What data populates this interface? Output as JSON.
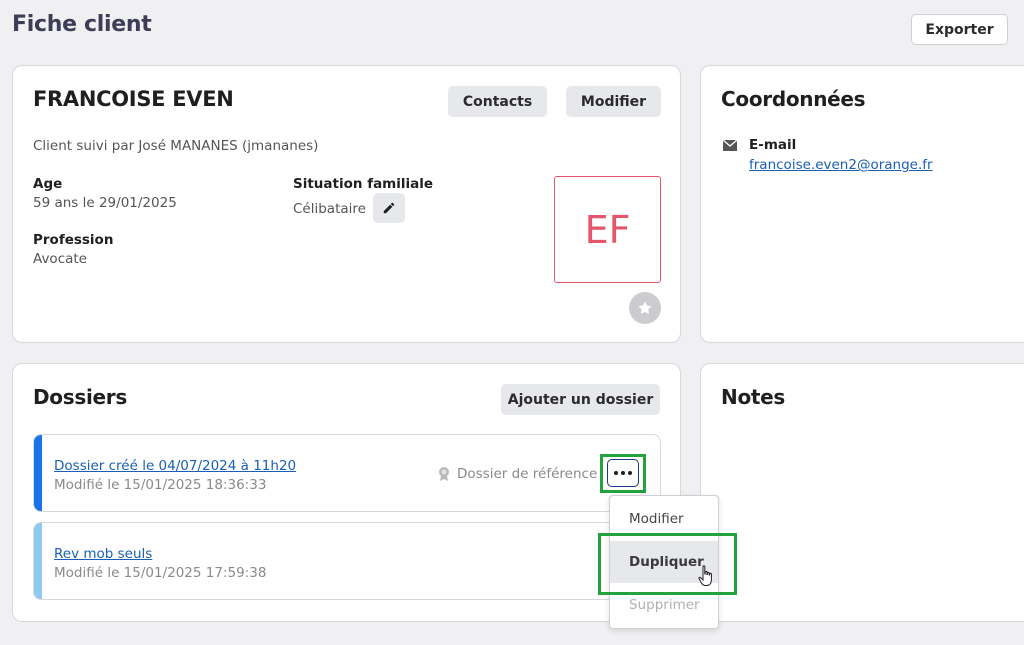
{
  "header": {
    "title": "Fiche client",
    "export_label": "Exporter"
  },
  "client": {
    "name": "FRANCOISE EVEN",
    "contacts_label": "Contacts",
    "modify_label": "Modifier",
    "followed_by": "Client suivi par José MANANES (jmananes)",
    "age_label": "Age",
    "age_value": "59 ans le 29/01/2025",
    "profession_label": "Profession",
    "profession_value": "Avocate",
    "situation_label": "Situation familiale",
    "situation_value": "Célibataire",
    "initials": "EF",
    "initials_color": "#e4576a"
  },
  "coordonnees": {
    "title": "Coordonnées",
    "email_label": "E-mail",
    "email_value": "francoise.even2@orange.fr"
  },
  "dossiers": {
    "title": "Dossiers",
    "add_label": "Ajouter un dossier",
    "items": [
      {
        "title": "Dossier créé le 04/07/2024 à 11h20",
        "modified": "Modifié le 15/01/2025 18:36:33",
        "reference_label": "Dossier de référence",
        "accent": "#1a73e8"
      },
      {
        "title": "Rev mob seuls",
        "modified": "Modifié le 15/01/2025 17:59:38",
        "accent": "#8ec9f2"
      }
    ]
  },
  "notes": {
    "title": "Notes"
  },
  "context_menu": {
    "items": [
      {
        "label": "Modifier"
      },
      {
        "label": "Dupliquer"
      },
      {
        "label": "Supprimer"
      }
    ]
  },
  "colors": {
    "highlight": "#22a33d",
    "link": "#1a5fb4"
  }
}
